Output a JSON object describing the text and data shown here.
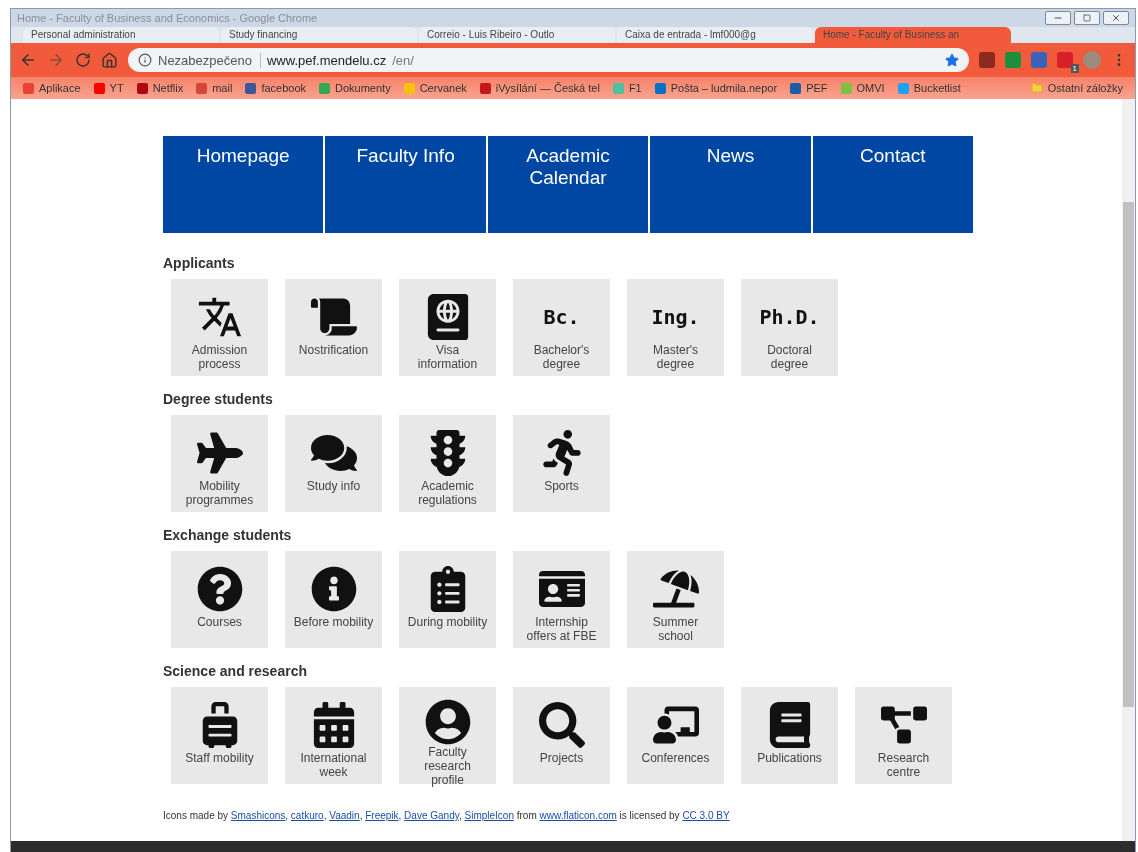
{
  "window": {
    "title": "Home - Faculty of Business and Economics - Google Chrome"
  },
  "tabs": [
    {
      "label": "Personal administration",
      "selected": false
    },
    {
      "label": "Study financing",
      "selected": false
    },
    {
      "label": "Correio - Luis Ribeiro - Outlo",
      "selected": false
    },
    {
      "label": "Caixa de entrada - lmf000@g",
      "selected": false
    },
    {
      "label": "Home - Faculty of Business an",
      "selected": true
    }
  ],
  "address": {
    "security": "Nezabezpečeno",
    "host": "www.pef.mendelu.cz",
    "path": "/en/",
    "starred": true
  },
  "extension_badge": "1",
  "bookmarks": [
    {
      "label": "Aplikace",
      "color": "#e94235"
    },
    {
      "label": "YT",
      "color": "#ff0000"
    },
    {
      "label": "Netflix",
      "color": "#b1060f"
    },
    {
      "label": "mail",
      "color": "#d44638"
    },
    {
      "label": "facebook",
      "color": "#3b5998"
    },
    {
      "label": "Dokumenty",
      "color": "#34a853"
    },
    {
      "label": "Cervanek",
      "color": "#f4c20d"
    },
    {
      "label": "iVysílání — Česká tel",
      "color": "#c4161c"
    },
    {
      "label": "F1",
      "color": "#4fbf9f"
    },
    {
      "label": "Pošta – ludmila.nepor",
      "color": "#0072c6"
    },
    {
      "label": "PEF",
      "color": "#1a5ea8"
    },
    {
      "label": "OMVI",
      "color": "#7cc242"
    },
    {
      "label": "Bucketlist",
      "color": "#1da1f2"
    }
  ],
  "other_bookmarks": "Ostatní záložky",
  "nav": [
    "Homepage",
    "Faculty Info",
    "Academic Calendar",
    "News",
    "Contact"
  ],
  "sections": [
    {
      "title": "Applicants",
      "tiles": [
        {
          "kind": "icon",
          "label": "Admission process"
        },
        {
          "kind": "icon",
          "label": "Nostrification"
        },
        {
          "kind": "icon",
          "label": "Visa information"
        },
        {
          "kind": "abbr",
          "abbr": "Bc.",
          "label": "Bachelor's degree"
        },
        {
          "kind": "abbr",
          "abbr": "Ing.",
          "label": "Master's degree"
        },
        {
          "kind": "abbr",
          "abbr": "Ph.D.",
          "label": "Doctoral degree"
        }
      ]
    },
    {
      "title": "Degree students",
      "tiles": [
        {
          "kind": "icon",
          "label": "Mobility programmes"
        },
        {
          "kind": "icon",
          "label": "Study info"
        },
        {
          "kind": "icon",
          "label": "Academic regulations"
        },
        {
          "kind": "icon",
          "label": "Sports"
        }
      ]
    },
    {
      "title": "Exchange students",
      "tiles": [
        {
          "kind": "icon",
          "label": "Courses"
        },
        {
          "kind": "icon",
          "label": "Before mobility"
        },
        {
          "kind": "icon",
          "label": "During mobility"
        },
        {
          "kind": "icon",
          "label": "Internship offers at FBE"
        },
        {
          "kind": "icon",
          "label": "Summer school"
        }
      ]
    },
    {
      "title": "Science and research",
      "tiles": [
        {
          "kind": "icon",
          "label": "Staff mobility"
        },
        {
          "kind": "icon",
          "label": "International week"
        },
        {
          "kind": "icon",
          "label": "Faculty research profile"
        },
        {
          "kind": "icon",
          "label": "Projects"
        },
        {
          "kind": "icon",
          "label": "Conferences"
        },
        {
          "kind": "icon",
          "label": "Publications"
        },
        {
          "kind": "icon",
          "label": "Research centre"
        }
      ]
    }
  ],
  "credits": {
    "prefix": "Icons made by",
    "authors": [
      "Smashicons",
      "catkuro",
      "Vaadin",
      "Freepik",
      "Dave Gandy",
      "SimpleIcon"
    ],
    "separator": ",",
    "from": "from",
    "site": "www.flaticon.com",
    "licensed": "is licensed by",
    "license": "CC 3.0 BY"
  }
}
